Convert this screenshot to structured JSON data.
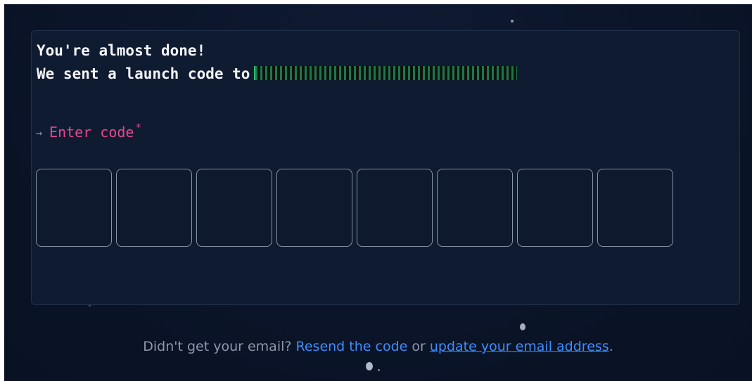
{
  "heading": {
    "line1": "You're almost done!",
    "line2_prefix": "We sent a launch code to"
  },
  "code_field": {
    "label": "Enter code",
    "arrow": "→",
    "required_marker": "*",
    "box_count": 8
  },
  "footer": {
    "prefix": "Didn't get your email?",
    "resend_link": "Resend the code",
    "connector": "or",
    "update_link": "update your email address",
    "suffix": "."
  },
  "colors": {
    "background": "#0b1428",
    "card": "#0f1b31",
    "label_pink": "#e9458f",
    "link_blue": "#3f8dff",
    "muted_text": "#8e97ab"
  }
}
